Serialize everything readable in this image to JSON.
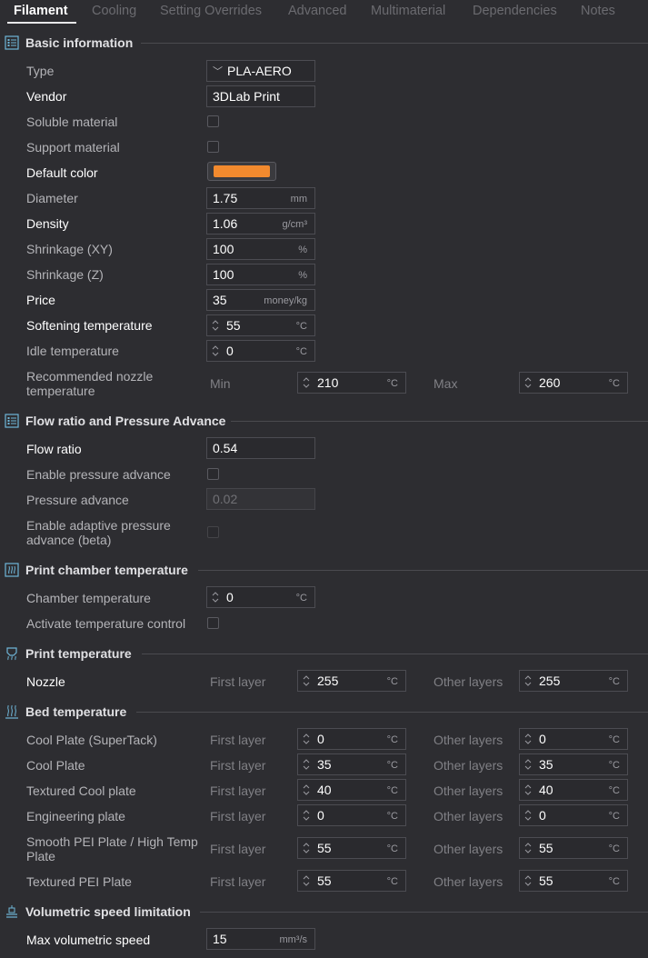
{
  "tabs": [
    "Filament",
    "Cooling",
    "Setting Overrides",
    "Advanced",
    "Multimaterial",
    "Dependencies",
    "Notes"
  ],
  "sections": {
    "basic": "Basic information",
    "flow": "Flow ratio and Pressure Advance",
    "chamber": "Print chamber temperature",
    "print_temp": "Print temperature",
    "bed_temp": "Bed temperature",
    "volumetric": "Volumetric speed limitation"
  },
  "basic": {
    "type_label": "Type",
    "type_value": "PLA-AERO",
    "vendor_label": "Vendor",
    "vendor_value": "3DLab Print",
    "soluble_label": "Soluble material",
    "support_label": "Support material",
    "color_label": "Default color",
    "color_value": "#f28a2e",
    "diameter_label": "Diameter",
    "diameter_value": "1.75",
    "diameter_unit": "mm",
    "density_label": "Density",
    "density_value": "1.06",
    "density_unit": "g/cm³",
    "shrink_xy_label": "Shrinkage (XY)",
    "shrink_xy_value": "100",
    "shrink_xy_unit": "%",
    "shrink_z_label": "Shrinkage (Z)",
    "shrink_z_value": "100",
    "shrink_z_unit": "%",
    "price_label": "Price",
    "price_value": "35",
    "price_unit": "money/kg",
    "soften_label": "Softening temperature",
    "soften_value": "55",
    "soften_unit": "°C",
    "idle_label": "Idle temperature",
    "idle_value": "0",
    "idle_unit": "°C",
    "nozzle_range_label": "Recommended nozzle temperature",
    "min_label": "Min",
    "min_value": "210",
    "min_unit": "°C",
    "max_label": "Max",
    "max_value": "260",
    "max_unit": "°C"
  },
  "flow": {
    "flow_ratio_label": "Flow ratio",
    "flow_ratio_value": "0.54",
    "enable_pa_label": "Enable pressure advance",
    "pa_label": "Pressure advance",
    "pa_value": "0.02",
    "adaptive_pa_label": "Enable adaptive pressure advance (beta)"
  },
  "chamber": {
    "chamber_label": "Chamber temperature",
    "chamber_value": "0",
    "chamber_unit": "°C",
    "activate_label": "Activate temperature control"
  },
  "print_temp": {
    "nozzle_label": "Nozzle",
    "first_layer_label": "First layer",
    "first_value": "255",
    "unit": "°C",
    "other_layers_label": "Other layers",
    "other_value": "255"
  },
  "bed": {
    "first_layer_label": "First layer",
    "other_layers_label": "Other layers",
    "unit": "°C",
    "rows": [
      {
        "label": "Cool Plate (SuperTack)",
        "first": "0",
        "other": "0"
      },
      {
        "label": "Cool Plate",
        "first": "35",
        "other": "35"
      },
      {
        "label": "Textured Cool plate",
        "first": "40",
        "other": "40"
      },
      {
        "label": "Engineering plate",
        "first": "0",
        "other": "0"
      },
      {
        "label": "Smooth PEI Plate / High Temp Plate",
        "first": "55",
        "other": "55"
      },
      {
        "label": "Textured PEI Plate",
        "first": "55",
        "other": "55"
      }
    ]
  },
  "volumetric": {
    "max_label": "Max volumetric speed",
    "max_value": "15",
    "max_unit": "mm³/s"
  },
  "icons": {
    "basic": "list-icon",
    "flow": "list-icon",
    "chamber": "chamber-heat-icon",
    "print_temp": "nozzle-heat-icon",
    "bed_temp": "bed-heat-icon",
    "volumetric": "speed-limit-icon"
  }
}
